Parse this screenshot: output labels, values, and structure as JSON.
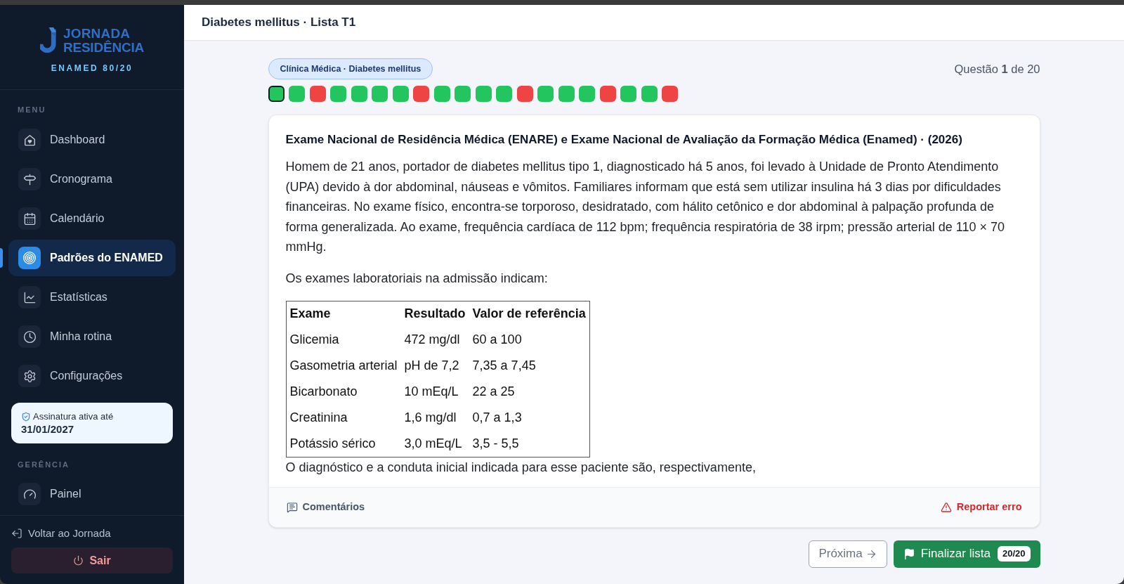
{
  "sidebar": {
    "logo": {
      "line_1": "JORNADA",
      "line_2": "RESIDÊNCIA",
      "subtitle": "ENAMED 80/20"
    },
    "menu_heading": "MENU",
    "menu_items": [
      {
        "label": "Dashboard",
        "selected": false
      },
      {
        "label": "Cronograma",
        "selected": false
      },
      {
        "label": "Calendário",
        "selected": false
      },
      {
        "label": "Padrões do ENAMED",
        "selected": true
      },
      {
        "label": "Estatísticas",
        "selected": false
      },
      {
        "label": "Minha rotina",
        "selected": false
      },
      {
        "label": "Configurações",
        "selected": false
      }
    ],
    "subscription": {
      "label": "Assinatura ativa até",
      "date": "31/01/2027"
    },
    "management_heading": "GERÊNCIA",
    "management_items": [
      {
        "label": "Painel",
        "selected": false
      }
    ],
    "back_link": "Voltar ao Jornada",
    "logout_button": "Sair"
  },
  "header": {
    "title": "Diabetes mellitus · Lista T1"
  },
  "question": {
    "tag": "Clínica Médica · Diabetes mellitus",
    "counter": "Questão **1** de 20",
    "navigator": [
      {
        "color": "#22c55e",
        "selected": true
      },
      {
        "color": "#22c55e",
        "selected": false
      },
      {
        "color": "#ef4444",
        "selected": false
      },
      {
        "color": "#22c55e",
        "selected": false
      },
      {
        "color": "#22c55e",
        "selected": false
      },
      {
        "color": "#22c55e",
        "selected": false
      },
      {
        "color": "#22c55e",
        "selected": false
      },
      {
        "color": "#ef4444",
        "selected": false
      },
      {
        "color": "#22c55e",
        "selected": false
      },
      {
        "color": "#22c55e",
        "selected": false
      },
      {
        "color": "#22c55e",
        "selected": false
      },
      {
        "color": "#22c55e",
        "selected": false
      },
      {
        "color": "#ef4444",
        "selected": false
      },
      {
        "color": "#22c55e",
        "selected": false
      },
      {
        "color": "#22c55e",
        "selected": false
      },
      {
        "color": "#22c55e",
        "selected": false
      },
      {
        "color": "#ef4444",
        "selected": false
      },
      {
        "color": "#22c55e",
        "selected": false
      },
      {
        "color": "#22c55e",
        "selected": false
      },
      {
        "color": "#ef4444",
        "selected": false
      }
    ],
    "source": "Exame Nacional de Residência Médica (ENARE) e Exame Nacional de Avaliação da Formação Médica (Enamed) · (2026)",
    "statement": "Homem de 21 anos, portador de diabetes mellitus tipo 1, diagnosticado há 5 anos, foi levado à Unidade de Pronto Atendimento (UPA) devido à dor abdominal, náuseas e vômitos. Familiares informam que está sem utilizar insulina há 3 dias por dificuldades financeiras. No exame físico, encontra-se torporoso, desidratado, com hálito cetônico e dor abdominal à palpação profunda de forma generalizada. Ao exame, frequência cardíaca de 112 bpm; frequência respiratória de 38 irpm; pressão arterial de 110 × 70 mmHg.",
    "intro": "Os exames laboratoriais na admissão indicam:",
    "table": {
      "columns": [
        "Exame",
        "Resultado",
        "Valor de referência"
      ],
      "rows": [
        [
          "Glicemia",
          "472 mg/dl",
          "60 a 100"
        ],
        [
          "Gasometria arterial",
          "pH de 7,2",
          "7,35 a 7,45"
        ],
        [
          "Bicarbonato",
          "10 mEq/L",
          "22 a 25"
        ],
        [
          "Creatinina",
          "1,6 mg/dl",
          "0,7 a 1,3"
        ],
        [
          "Potássio sérico",
          "3,0 mEq/L",
          "3,5 - 5,5"
        ]
      ]
    },
    "prompt": "O diagnóstico e a conduta inicial indicada para esse paciente são, respectivamente,",
    "comments_button": "Comentários",
    "report_button": "Reportar erro"
  },
  "actions": {
    "next_button": "Próxima",
    "finish_button": {
      "label": "Finalizar lista",
      "badge": "20/20"
    }
  }
}
